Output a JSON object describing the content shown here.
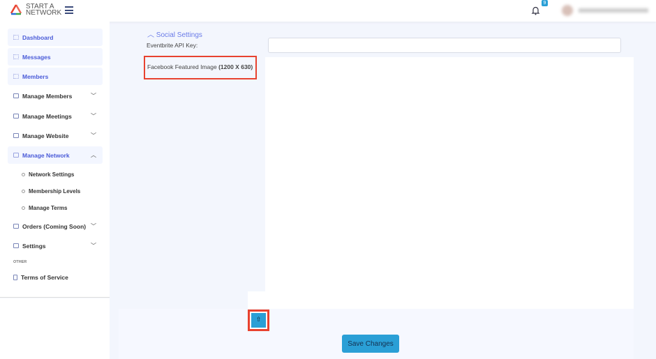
{
  "header": {
    "logo_line1": "START A",
    "logo_line2": "NETWORK",
    "notification_count": "9"
  },
  "sidebar": {
    "items": [
      {
        "label": "Dashboard"
      },
      {
        "label": "Messages"
      },
      {
        "label": "Members"
      },
      {
        "label": "Manage Members"
      },
      {
        "label": "Manage Meetings"
      },
      {
        "label": "Manage Website"
      },
      {
        "label": "Manage Network"
      },
      {
        "label": "Orders (Coming Soon)"
      },
      {
        "label": "Settings"
      }
    ],
    "subitems": [
      {
        "label": "Network Settings"
      },
      {
        "label": "Membership Levels"
      },
      {
        "label": "Manage Terms"
      }
    ],
    "other_heading": "OTHER",
    "terms": "Terms of Service"
  },
  "main": {
    "section_title": "Social Settings",
    "eventbrite_label": "Eventbrite API Key:",
    "eventbrite_value": "",
    "facebook_label": "Facebook Featured Image",
    "facebook_size": "(1200 X 630)",
    "upload_icon": "upload-icon",
    "save_label": "Save Changes"
  }
}
